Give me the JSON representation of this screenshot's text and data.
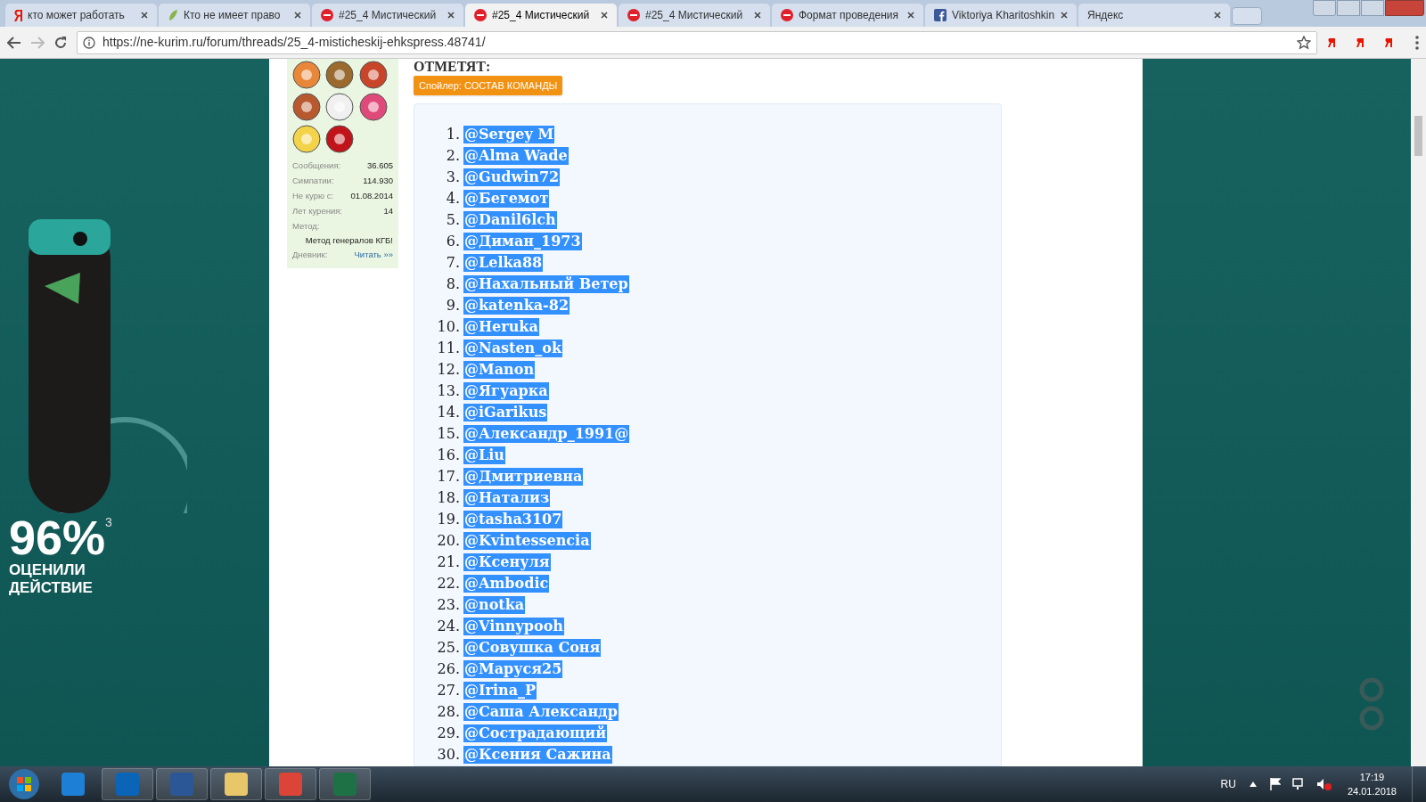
{
  "browser": {
    "tabs": [
      {
        "title": "кто может работать",
        "kind": "yandex",
        "selected": false
      },
      {
        "title": "Кто не имеет право",
        "kind": "leaf",
        "selected": false
      },
      {
        "title": "#25_4 Мистический",
        "kind": "forum",
        "selected": false
      },
      {
        "title": "#25_4 Мистический",
        "kind": "forum",
        "selected": true
      },
      {
        "title": "#25_4 Мистический",
        "kind": "forum",
        "selected": false
      },
      {
        "title": "Формат проведения",
        "kind": "forum",
        "selected": false
      },
      {
        "title": "Viktoriya Kharitoshkin",
        "kind": "facebook",
        "selected": false
      },
      {
        "title": "Яндекс",
        "kind": "none",
        "selected": false
      }
    ],
    "url": "https://ne-kurim.ru/forum/threads/25_4-misticheskij-ehkspress.48741/"
  },
  "ad_banner": {
    "big": "96%",
    "superscript": "3",
    "lines": [
      "ОЦЕНИЛИ",
      "ДЕЙСТВИЕ"
    ]
  },
  "user_panel": {
    "stats": [
      {
        "label": "Сообщения:",
        "value": "36.605"
      },
      {
        "label": "Симпатии:",
        "value": "114.930"
      },
      {
        "label": "Не курю с:",
        "value": "01.08.2014"
      },
      {
        "label": "Лет курения:",
        "value": "14"
      }
    ],
    "method_label": "Метод:",
    "method_value": "Метод генералов КГБ!",
    "diary_label": "Дневник:",
    "diary_link": "Читать »»"
  },
  "post": {
    "heading": "ОТМЕТЯТ:",
    "spoiler": "Спойлер: СОСТАВ КОМАНДЫ",
    "members": [
      {
        "number": "1.",
        "name": "@Sergey M"
      },
      {
        "number": "2.",
        "name": "@Alma Wade"
      },
      {
        "number": "3.",
        "name": "@Gudwin72"
      },
      {
        "number": "4.",
        "name": "@Бегемот"
      },
      {
        "number": "5.",
        "name": "@Danil6lch"
      },
      {
        "number": "6.",
        "name": "@Диман_1973"
      },
      {
        "number": "7.",
        "name": "@Lelka88"
      },
      {
        "number": "8.",
        "name": "@Нахальный Ветер"
      },
      {
        "number": "9.",
        "name": "@katenka-82"
      },
      {
        "number": "10.",
        "name": "@Heruka"
      },
      {
        "number": "11.",
        "name": "@Nasten_ok"
      },
      {
        "number": "12.",
        "name": "@Manon"
      },
      {
        "number": "13.",
        "name": "@Ягуарка"
      },
      {
        "number": "14.",
        "name": "@iGarikus"
      },
      {
        "number": "15.",
        "name": "@Александр_1991@"
      },
      {
        "number": "16.",
        "name": "@Liu"
      },
      {
        "number": "17.",
        "name": "@Дмитриевна"
      },
      {
        "number": "18.",
        "name": "@Натализ"
      },
      {
        "number": "19.",
        "name": "@tasha3107"
      },
      {
        "number": "20.",
        "name": "@Kvintessencia"
      },
      {
        "number": "21.",
        "name": "@Ксенуля"
      },
      {
        "number": "22.",
        "name": "@Ambodic"
      },
      {
        "number": "23.",
        "name": "@notka"
      },
      {
        "number": "24.",
        "name": "@Vinnypooh"
      },
      {
        "number": "25.",
        "name": "@Совушка Соня"
      },
      {
        "number": "26.",
        "name": "@Маруся25"
      },
      {
        "number": "27.",
        "name": "@Irina_P"
      },
      {
        "number": "28.",
        "name": "@Саша Александр"
      },
      {
        "number": "29.",
        "name": "@Сострадающий"
      },
      {
        "number": "30.",
        "name": "@Ксения Сажина"
      }
    ]
  },
  "taskbar": {
    "language": "RU",
    "time": "17:19",
    "date": "24.01.2018"
  }
}
